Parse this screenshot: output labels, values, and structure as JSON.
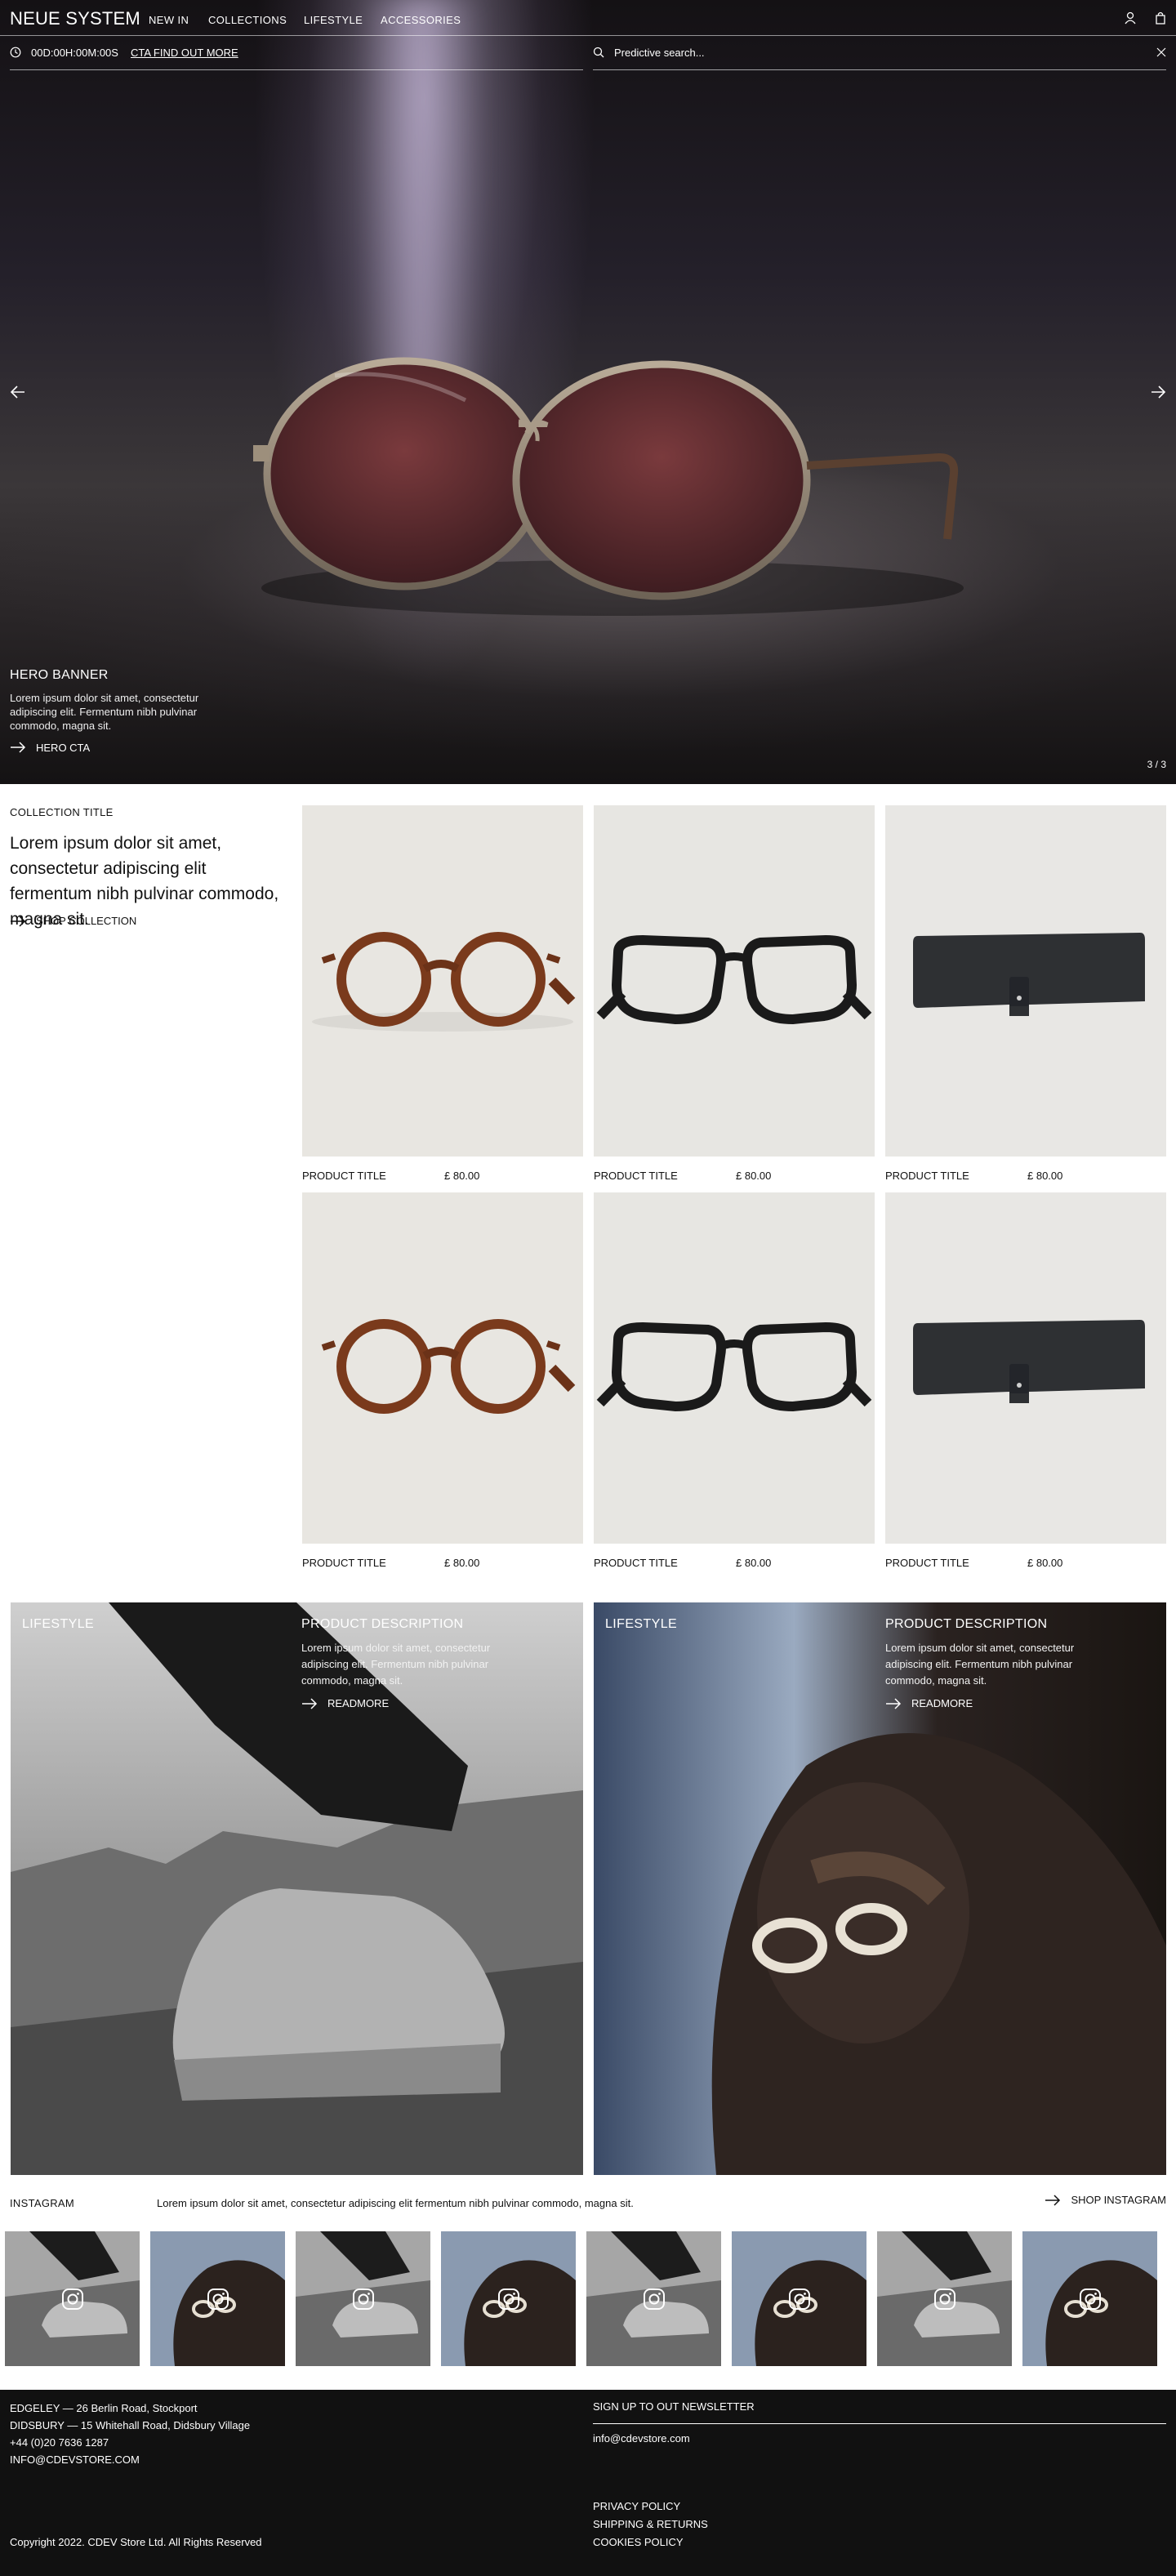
{
  "header": {
    "logo": "NEUE SYSTEM",
    "nav": [
      "NEW IN",
      "COLLECTIONS",
      "LIFESTYLE",
      "ACCESSORIES"
    ],
    "icons": [
      "account-icon",
      "bag-icon"
    ]
  },
  "promo": {
    "countdown": "00D:00H:00M:00S",
    "cta": "CTA FIND OUT MORE"
  },
  "search": {
    "placeholder": "Predictive search..."
  },
  "hero": {
    "title": "HERO BANNER",
    "text": "Lorem ipsum dolor sit amet, consectetur adipiscing elit. Fermentum nibh pulvinar commodo, magna sit.",
    "cta": "HERO CTA",
    "counter": "3 / 3"
  },
  "collection": {
    "title": "COLLECTION TITLE",
    "text": "Lorem ipsum dolor sit amet, consectetur adipiscing elit fermentum nibh pulvinar commodo, magna sit.",
    "cta": "SHOP COLLECTION",
    "products": [
      {
        "title": "PRODUCT TITLE",
        "price": "£ 80.00",
        "image": "tortoise-glasses"
      },
      {
        "title": "PRODUCT TITLE",
        "price": "£ 80.00",
        "image": "black-glasses"
      },
      {
        "title": "PRODUCT TITLE",
        "price": "£ 80.00",
        "image": "glasses-case"
      },
      {
        "title": "PRODUCT TITLE",
        "price": "£ 80.00",
        "image": "tortoise-glasses"
      },
      {
        "title": "PRODUCT TITLE",
        "price": "£ 80.00",
        "image": "black-glasses"
      },
      {
        "title": "PRODUCT TITLE",
        "price": "£ 80.00",
        "image": "glasses-case"
      }
    ]
  },
  "lifestyle": [
    {
      "label": "LIFESTYLE",
      "title": "PRODUCT DESCRIPTION",
      "text": "Lorem ipsum dolor sit amet, consectetur adipiscing elit. Fermentum nibh pulvinar commodo, magna sit.",
      "cta": "READMORE"
    },
    {
      "label": "LIFESTYLE",
      "title": "PRODUCT DESCRIPTION",
      "text": "Lorem ipsum dolor sit amet, consectetur adipiscing elit. Fermentum nibh pulvinar commodo, magna sit.",
      "cta": "READMORE"
    }
  ],
  "instagram": {
    "label": "INSTAGRAM",
    "text": "Lorem ipsum dolor sit amet, consectetur adipiscing elit fermentum nibh pulvinar commodo, magna sit.",
    "cta": "SHOP INSTAGRAM"
  },
  "footer": {
    "address1": "EDGELEY — 26 Berlin Road, Stockport",
    "address2": "DIDSBURY — 15 Whitehall Road, Didsbury Village",
    "phone": "+44 (0)20 7636 1287",
    "email": "INFO@CDEVSTORE.COM",
    "newsletter_title": "SIGN UP TO OUT NEWSLETTER",
    "newsletter_value": "info@cdevstore.com",
    "links": [
      "PRIVACY POLICY",
      "SHIPPING & RETURNS",
      "COOKIES POLICY"
    ],
    "copyright": "Copyright 2022. CDEV Store Ltd. All Rights Reserved"
  }
}
